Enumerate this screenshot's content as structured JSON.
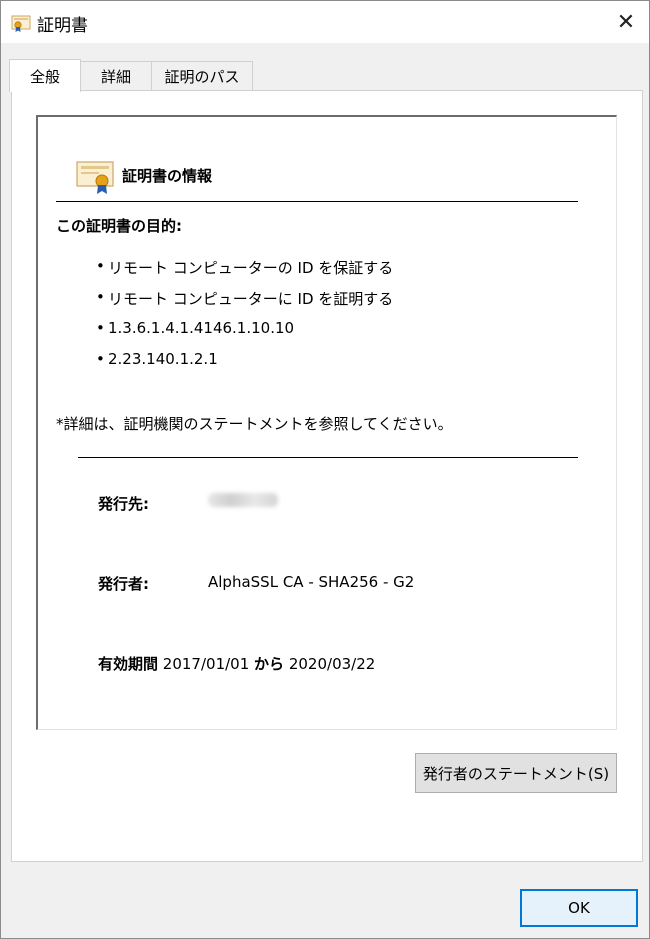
{
  "window": {
    "title": "証明書",
    "icons": {
      "title": "certificate-icon",
      "close": "close-icon"
    }
  },
  "tabs": [
    {
      "label": "全般",
      "active": true
    },
    {
      "label": "詳細",
      "active": false
    },
    {
      "label": "証明のパス",
      "active": false
    }
  ],
  "general": {
    "info_title": "証明書の情報",
    "purpose_title": "この証明書の目的:",
    "purposes": [
      "リモート コンピューターの ID を保証する",
      "リモート コンピューターに ID を証明する",
      "1.3.6.1.4.1.4146.1.10.10",
      "2.23.140.1.2.1"
    ],
    "bullet": "•",
    "note": "*詳細は、証明機関のステートメントを参照してください。",
    "issued_to_label": "発行先:",
    "issued_by_label": "発行者:",
    "issued_by_value": "AlphaSSL CA - SHA256 - G2",
    "validity_label": "有効期間",
    "valid_from": "2017/01/01",
    "from_word": "から",
    "valid_to": "2020/03/22"
  },
  "buttons": {
    "statement": "発行者のステートメント(S)",
    "ok": "OK",
    "close_glyph": "✕"
  }
}
